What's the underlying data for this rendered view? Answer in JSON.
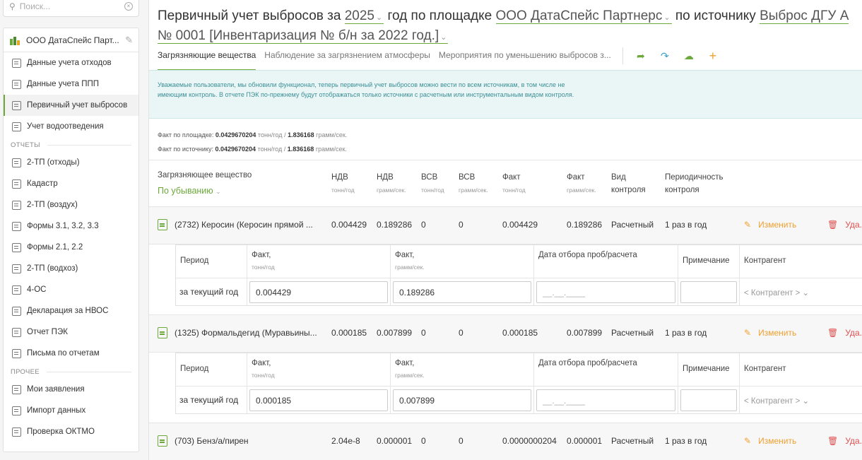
{
  "sidebar": {
    "search_placeholder": "Поиск...",
    "org_name": "ООО ДатаСпейс Парт...",
    "items": [
      {
        "label": "Данные учета отходов"
      },
      {
        "label": "Данные учета ППП"
      },
      {
        "label": "Первичный учет выбросов"
      },
      {
        "label": "Учет водоотведения"
      }
    ],
    "reports_title": "ОТЧЕТЫ",
    "reports": [
      {
        "label": "2-ТП (отходы)"
      },
      {
        "label": "Кадастр"
      },
      {
        "label": "2-ТП (воздух)"
      },
      {
        "label": "Формы 3.1, 3.2, 3.3"
      },
      {
        "label": "Формы 2.1, 2.2"
      },
      {
        "label": "2-ТП (водхоз)"
      },
      {
        "label": "4-ОС"
      },
      {
        "label": "Декларация за НВОС"
      },
      {
        "label": "Отчет ПЭК"
      },
      {
        "label": "Письма по отчетам"
      }
    ],
    "other_title": "ПРОЧЕЕ",
    "other": [
      {
        "label": "Мои заявления"
      },
      {
        "label": "Импорт данных"
      },
      {
        "label": "Проверка ОКТМО"
      }
    ]
  },
  "header": {
    "t1": "Первичный учет выбросов за",
    "year": "2025",
    "t2": "год по площадке",
    "org": "ООО ДатаСпейс Партнерс",
    "t3": "по источнику",
    "source": "Выброс ДГУ А № 0001 [Инвентаризация № б/н за 2022 год.]"
  },
  "tabs": [
    "Загрязняющие вещества",
    "Наблюдение за загрязнением атмосферы",
    "Мероприятия по уменьшению выбросов з..."
  ],
  "notice": "Уважаемые пользователи, мы обновили функционал, теперь первичный учет выбросов можно вести по всем источникам, в том числе не имеющим контроль. В отчете ПЭК по-прежнему будут отображаться только источники с расчетным или инструментальным видом контроля.",
  "facts": {
    "site_label": "Факт по площадке:",
    "site_tons": "0.0429670204",
    "site_g": "1.836168",
    "source_label": "Факт по источнику:",
    "source_tons": "0.0429670204",
    "source_g": "1.836168",
    "unit_tons": "тонн/год",
    "unit_g": "грамм/сек.",
    "sep": "/"
  },
  "table": {
    "h_substance": "Загрязняющее вещество",
    "sort": "По убыванию",
    "h_ndv_t": "НДВ",
    "h_ndv_t_u": "тонн/год",
    "h_ndv_g": "НДВ",
    "h_ndv_g_u": "грамм/сек.",
    "h_vsv_t": "ВСВ",
    "h_vsv_t_u": "тонн/год",
    "h_vsv_g": "ВСВ",
    "h_vsv_g_u": "грамм/сек.",
    "h_fact_t": "Факт",
    "h_fact_t_u": "тонн/год",
    "h_fact_g": "Факт",
    "h_fact_g_u": "грамм/сек.",
    "h_type": "Вид контроля",
    "h_period": "Периодичность контроля",
    "edit": "Изменить",
    "delete": "Уда...",
    "rows": [
      {
        "name": "(2732) Керосин (Керосин прямой ...",
        "ndv_t": "0.004429",
        "ndv_g": "0.189286",
        "vsv_t": "0",
        "vsv_g": "0",
        "fact_t": "0.004429",
        "fact_g": "0.189286",
        "type": "Расчетный",
        "period": "1 раз в год"
      },
      {
        "name": "(1325) Формальдегид (Муравьины...",
        "ndv_t": "0.000185",
        "ndv_g": "0.007899",
        "vsv_t": "0",
        "vsv_g": "0",
        "fact_t": "0.000185",
        "fact_g": "0.007899",
        "type": "Расчетный",
        "period": "1 раз в год"
      },
      {
        "name": "(703) Бенз/а/пирен",
        "ndv_t": "2.04e-8",
        "ndv_g": "0.000001",
        "vsv_t": "0",
        "vsv_g": "0",
        "fact_t": "0.0000000204",
        "fact_g": "0.000001",
        "type": "Расчетный",
        "period": "1 раз в год"
      }
    ]
  },
  "sub": {
    "h_period": "Период",
    "h_fact_t": "Факт,",
    "h_fact_t_u": "тонн/год",
    "h_fact_g": "Факт,",
    "h_fact_g_u": "грамм/сек.",
    "h_date": "Дата отбора проб/расчета",
    "h_note": "Примечание",
    "h_contr": "Контрагент",
    "period_value": "за текущий год",
    "date_placeholder": "__.__.____",
    "contr_placeholder": "< Контрагент >",
    "rows": [
      {
        "fact_t": "0.004429",
        "fact_g": "0.189286"
      },
      {
        "fact_t": "0.000185",
        "fact_g": "0.007899"
      }
    ]
  }
}
